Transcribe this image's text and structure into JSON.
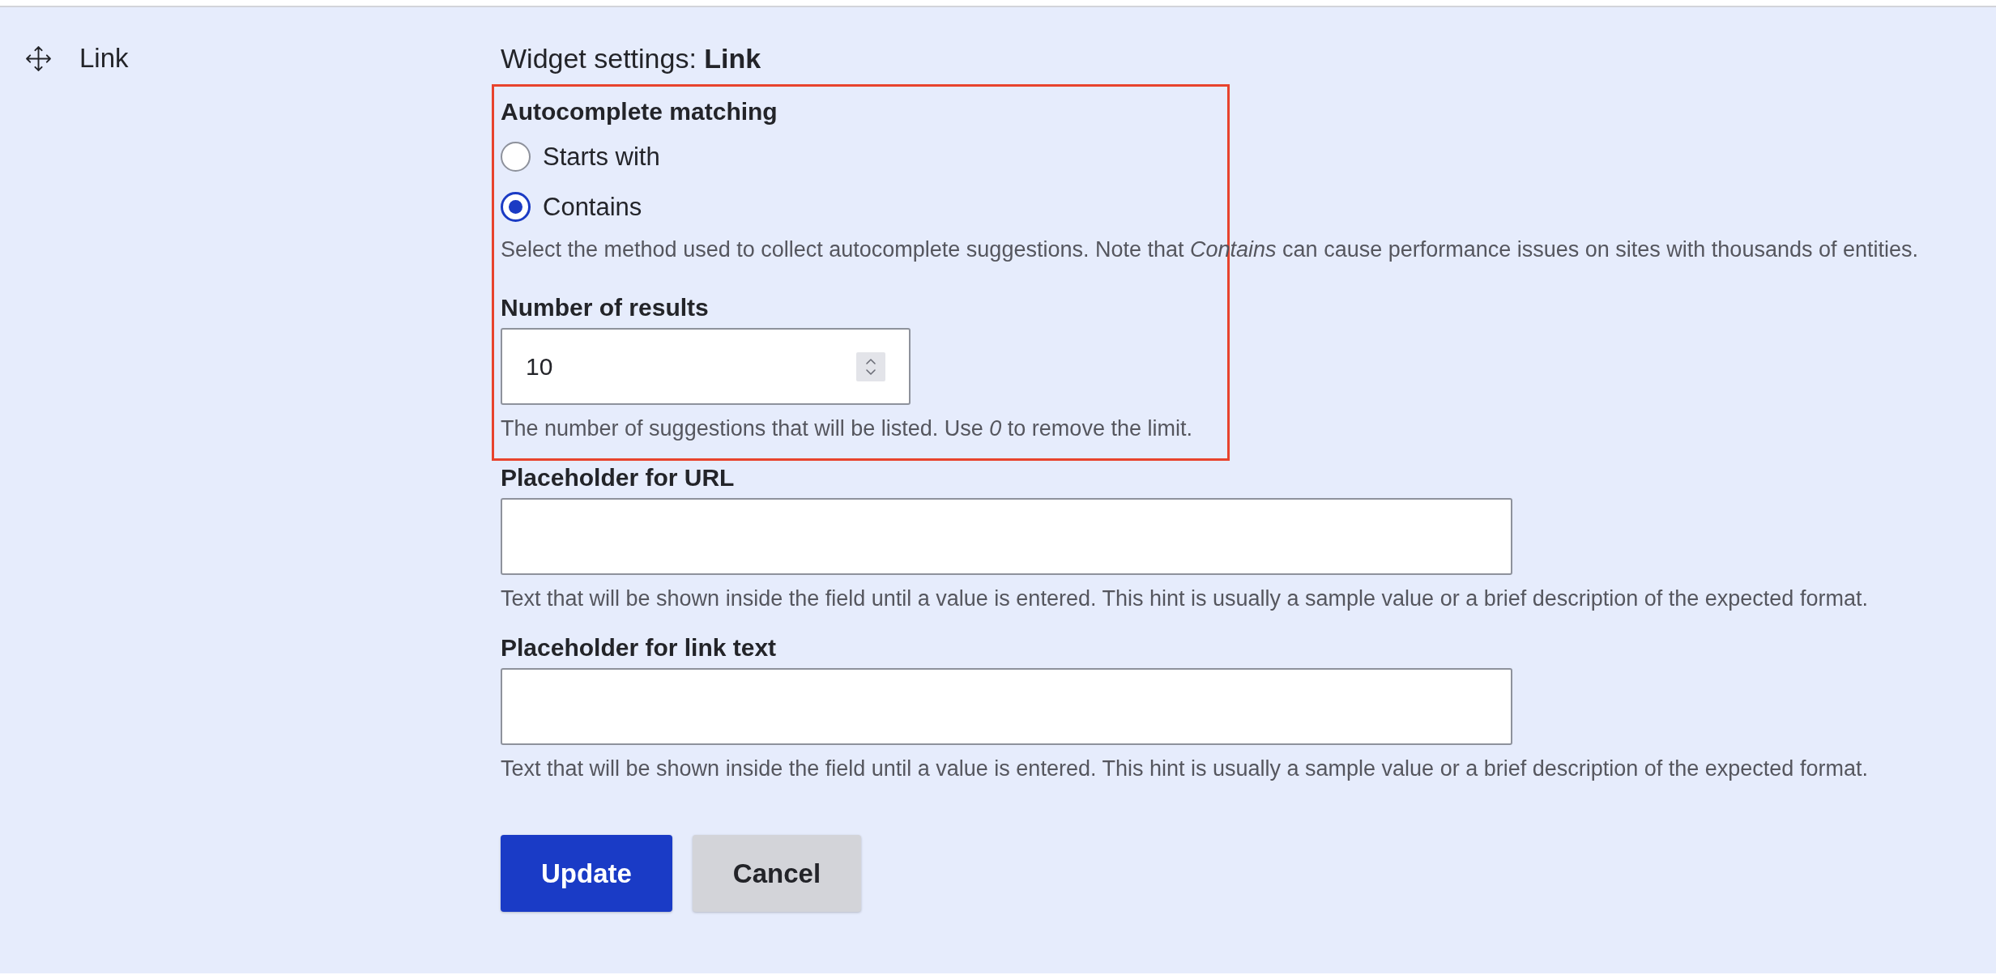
{
  "row": {
    "label": "Link"
  },
  "settings": {
    "title": "Widget settings: **Link**",
    "fields": [
      {
        "kind": "radios",
        "label": "Autocomplete matching",
        "highlighted": true,
        "options": [
          {
            "label": "Starts with",
            "selected": false
          },
          {
            "label": "Contains",
            "selected": true
          }
        ],
        "description": "Select the method used to collect autocomplete suggestions. Note that *Contains* can cause performance issues on sites with thousands of entities."
      },
      {
        "kind": "number",
        "label": "Number of results",
        "highlighted": true,
        "value": "10",
        "description": "The number of suggestions that will be listed. Use *0* to remove the limit."
      },
      {
        "kind": "text",
        "label": "Placeholder for URL",
        "highlighted": false,
        "description": "Text that will be shown inside the field until a value is entered. This hint is usually a sample value or a brief description of the expected format."
      },
      {
        "kind": "text",
        "label": "Placeholder for link text",
        "highlighted": false,
        "description": "Text that will be shown inside the field until a value is entered. This hint is usually a sample value or a brief description of the expected format."
      }
    ],
    "buttons": [
      {
        "label": "Update",
        "kind": "primary"
      },
      {
        "label": "Cancel",
        "kind": "secondary"
      }
    ]
  }
}
